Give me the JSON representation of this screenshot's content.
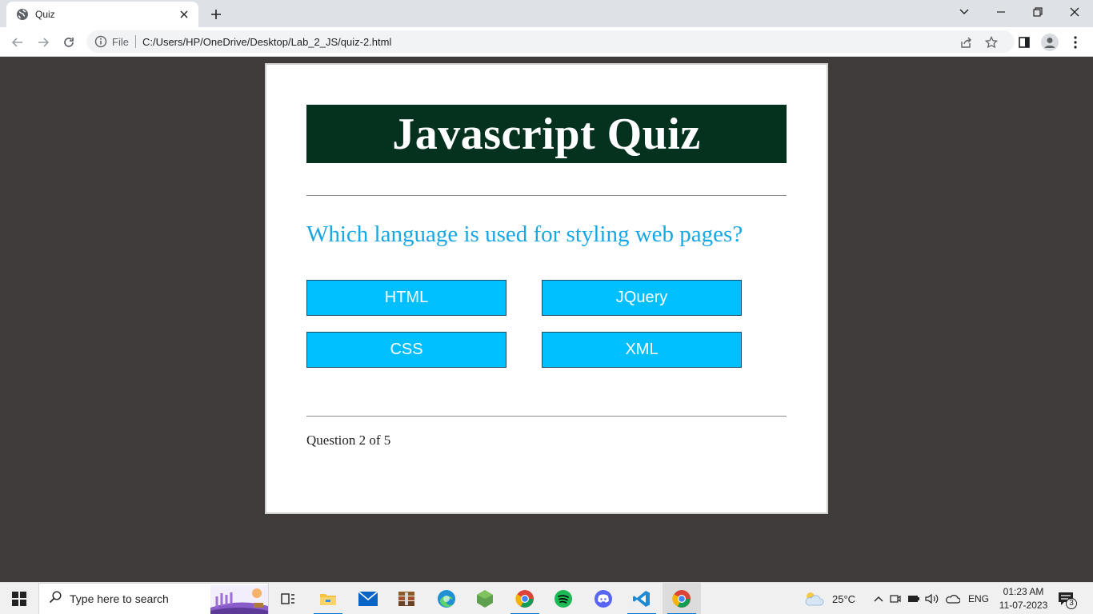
{
  "browser": {
    "tab_title": "Quiz",
    "address_scheme_label": "File",
    "url": "C:/Users/HP/OneDrive/Desktop/Lab_2_JS/quiz-2.html"
  },
  "quiz": {
    "title": "Javascript Quiz",
    "question": "Which language is used for styling web pages?",
    "choices": [
      "HTML",
      "JQuery",
      "CSS",
      "XML"
    ],
    "progress_text": "Question 2 of 5"
  },
  "taskbar": {
    "search_placeholder": "Type here to search",
    "weather_temp": "25°C",
    "language": "ENG",
    "time": "01:23 AM",
    "date": "11-07-2023",
    "notification_count": "3",
    "apps": [
      "task-view",
      "file-explorer",
      "mail",
      "archive-app",
      "edge",
      "nodejs",
      "chrome",
      "spotify",
      "discord",
      "vscode",
      "chrome"
    ]
  },
  "colors": {
    "page_background": "#3f3b3a",
    "header_background": "#04321f",
    "question_text": "#17a8e3",
    "choice_button": "#00bfff"
  }
}
